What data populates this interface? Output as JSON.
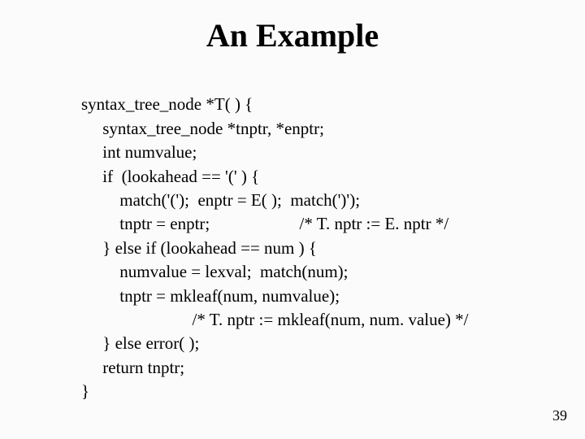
{
  "title": "An Example",
  "code": {
    "l1": "syntax_tree_node *T( ) {",
    "l2": "     syntax_tree_node *tnptr, *enptr;",
    "l3": "     int numvalue;",
    "l4": "     if  (lookahead == '(' ) {",
    "l5": "         match('(');  enptr = E( );  match(')');",
    "l6": "         tnptr = enptr;                     /* T. nptr := E. nptr */",
    "l7": "     } else if (lookahead == num ) {",
    "l8": "         numvalue = lexval;  match(num);",
    "l9": "         tnptr = mkleaf(num, numvalue);",
    "l10": "                          /* T. nptr := mkleaf(num, num. value) */",
    "l11": "     } else error( );",
    "l12": "     return tnptr;",
    "l13": "}"
  },
  "page_number": "39"
}
